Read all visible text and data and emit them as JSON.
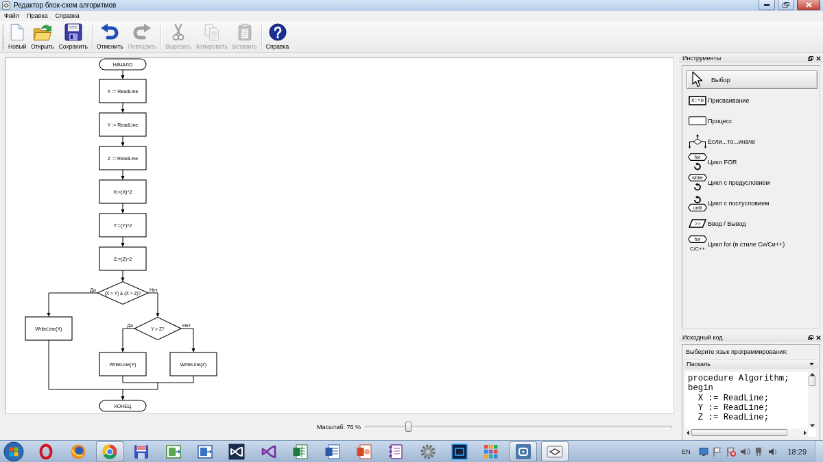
{
  "window": {
    "title": "Редактор блок-схем алгоритмов"
  },
  "menu": [
    "Файл",
    "Правка",
    "Справка"
  ],
  "toolbar": {
    "groups": [
      {
        "buttons": [
          {
            "label": "Новый",
            "disabled": false
          },
          {
            "label": "Открыть",
            "disabled": false
          },
          {
            "label": "Сохранить",
            "disabled": false
          }
        ]
      },
      {
        "buttons": [
          {
            "label": "Отменить",
            "disabled": false
          },
          {
            "label": "Повторить",
            "disabled": true
          }
        ]
      },
      {
        "buttons": [
          {
            "label": "Вырезать",
            "disabled": true
          },
          {
            "label": "Копировать",
            "disabled": true
          },
          {
            "label": "Вставить",
            "disabled": true
          }
        ]
      },
      {
        "buttons": [
          {
            "label": "Справка",
            "disabled": false
          }
        ]
      }
    ]
  },
  "flowchart": {
    "nodes": [
      {
        "kind": "terminal",
        "text": "НАЧАЛО"
      },
      {
        "kind": "process",
        "text": "X := ReadLine"
      },
      {
        "kind": "process",
        "text": "Y := ReadLine"
      },
      {
        "kind": "process",
        "text": "Z := ReadLine"
      },
      {
        "kind": "process",
        "text": "X:=(X)^2"
      },
      {
        "kind": "process",
        "text": "Y:=(Y)^2"
      },
      {
        "kind": "process",
        "text": "Z:=(Z)^2"
      },
      {
        "kind": "decision",
        "text": "(X > Y) & (X > Z)?",
        "yes_label": "Да",
        "no_label": "Нет"
      },
      {
        "kind": "process",
        "text": "WriteLine(X)"
      },
      {
        "kind": "decision",
        "text": "Y > Z?",
        "yes_label": "Да",
        "no_label": "Нет"
      },
      {
        "kind": "process",
        "text": "WriteLine(Y)"
      },
      {
        "kind": "process",
        "text": "WriteLine(Z)"
      },
      {
        "kind": "terminal",
        "text": "КОНЕЦ"
      }
    ]
  },
  "zoom": {
    "label": "Масштаб: 76 %",
    "level": 0.14
  },
  "tools_panel": {
    "title": "Инструменты",
    "items": [
      {
        "label": "Выбор",
        "selected": true
      },
      {
        "label": "Присваивание",
        "selected": false,
        "icon_texts": [
          "X:=0"
        ]
      },
      {
        "label": "Процесс",
        "selected": false
      },
      {
        "label": "Если...то...иначе",
        "selected": false
      },
      {
        "label": "Цикл FOR",
        "selected": false,
        "icon_texts": [
          "for"
        ]
      },
      {
        "label": "Цикл с предусловием",
        "selected": false,
        "icon_texts": [
          "while"
        ]
      },
      {
        "label": "Цикл с постусловием",
        "selected": false,
        "icon_texts": [
          "until"
        ]
      },
      {
        "label": "Ввод / Вывод",
        "selected": false,
        "icon_texts": [
          ">>"
        ]
      },
      {
        "label": "Цикл for (в стиле Си/Си++)",
        "selected": false,
        "icon_texts": [
          "for",
          "C/C++"
        ]
      }
    ]
  },
  "source_panel": {
    "title": "Исходный код",
    "prompt": "Выберите язык программирования:",
    "language": "Паскаль",
    "code": [
      "procedure Algorithm;",
      "begin",
      "  X := ReadLine;",
      "  Y := ReadLine;",
      "  Z := ReadLine;"
    ]
  },
  "taskbar": {
    "apps": [
      {
        "running": false,
        "selected": false
      },
      {
        "running": false,
        "selected": false
      },
      {
        "running": true,
        "selected": false
      },
      {
        "running": false,
        "selected": false
      },
      {
        "running": false,
        "selected": false
      },
      {
        "running": false,
        "selected": false
      },
      {
        "running": false,
        "selected": false
      },
      {
        "running": false,
        "selected": false
      },
      {
        "running": false,
        "selected": false
      },
      {
        "running": false,
        "selected": false
      },
      {
        "running": false,
        "selected": false
      },
      {
        "running": false,
        "selected": false
      },
      {
        "running": false,
        "selected": false
      },
      {
        "running": false,
        "selected": false
      },
      {
        "running": false,
        "selected": false
      },
      {
        "running": true,
        "selected": false
      },
      {
        "running": true,
        "selected": true
      }
    ],
    "language": "EN",
    "clock": "18:29"
  }
}
